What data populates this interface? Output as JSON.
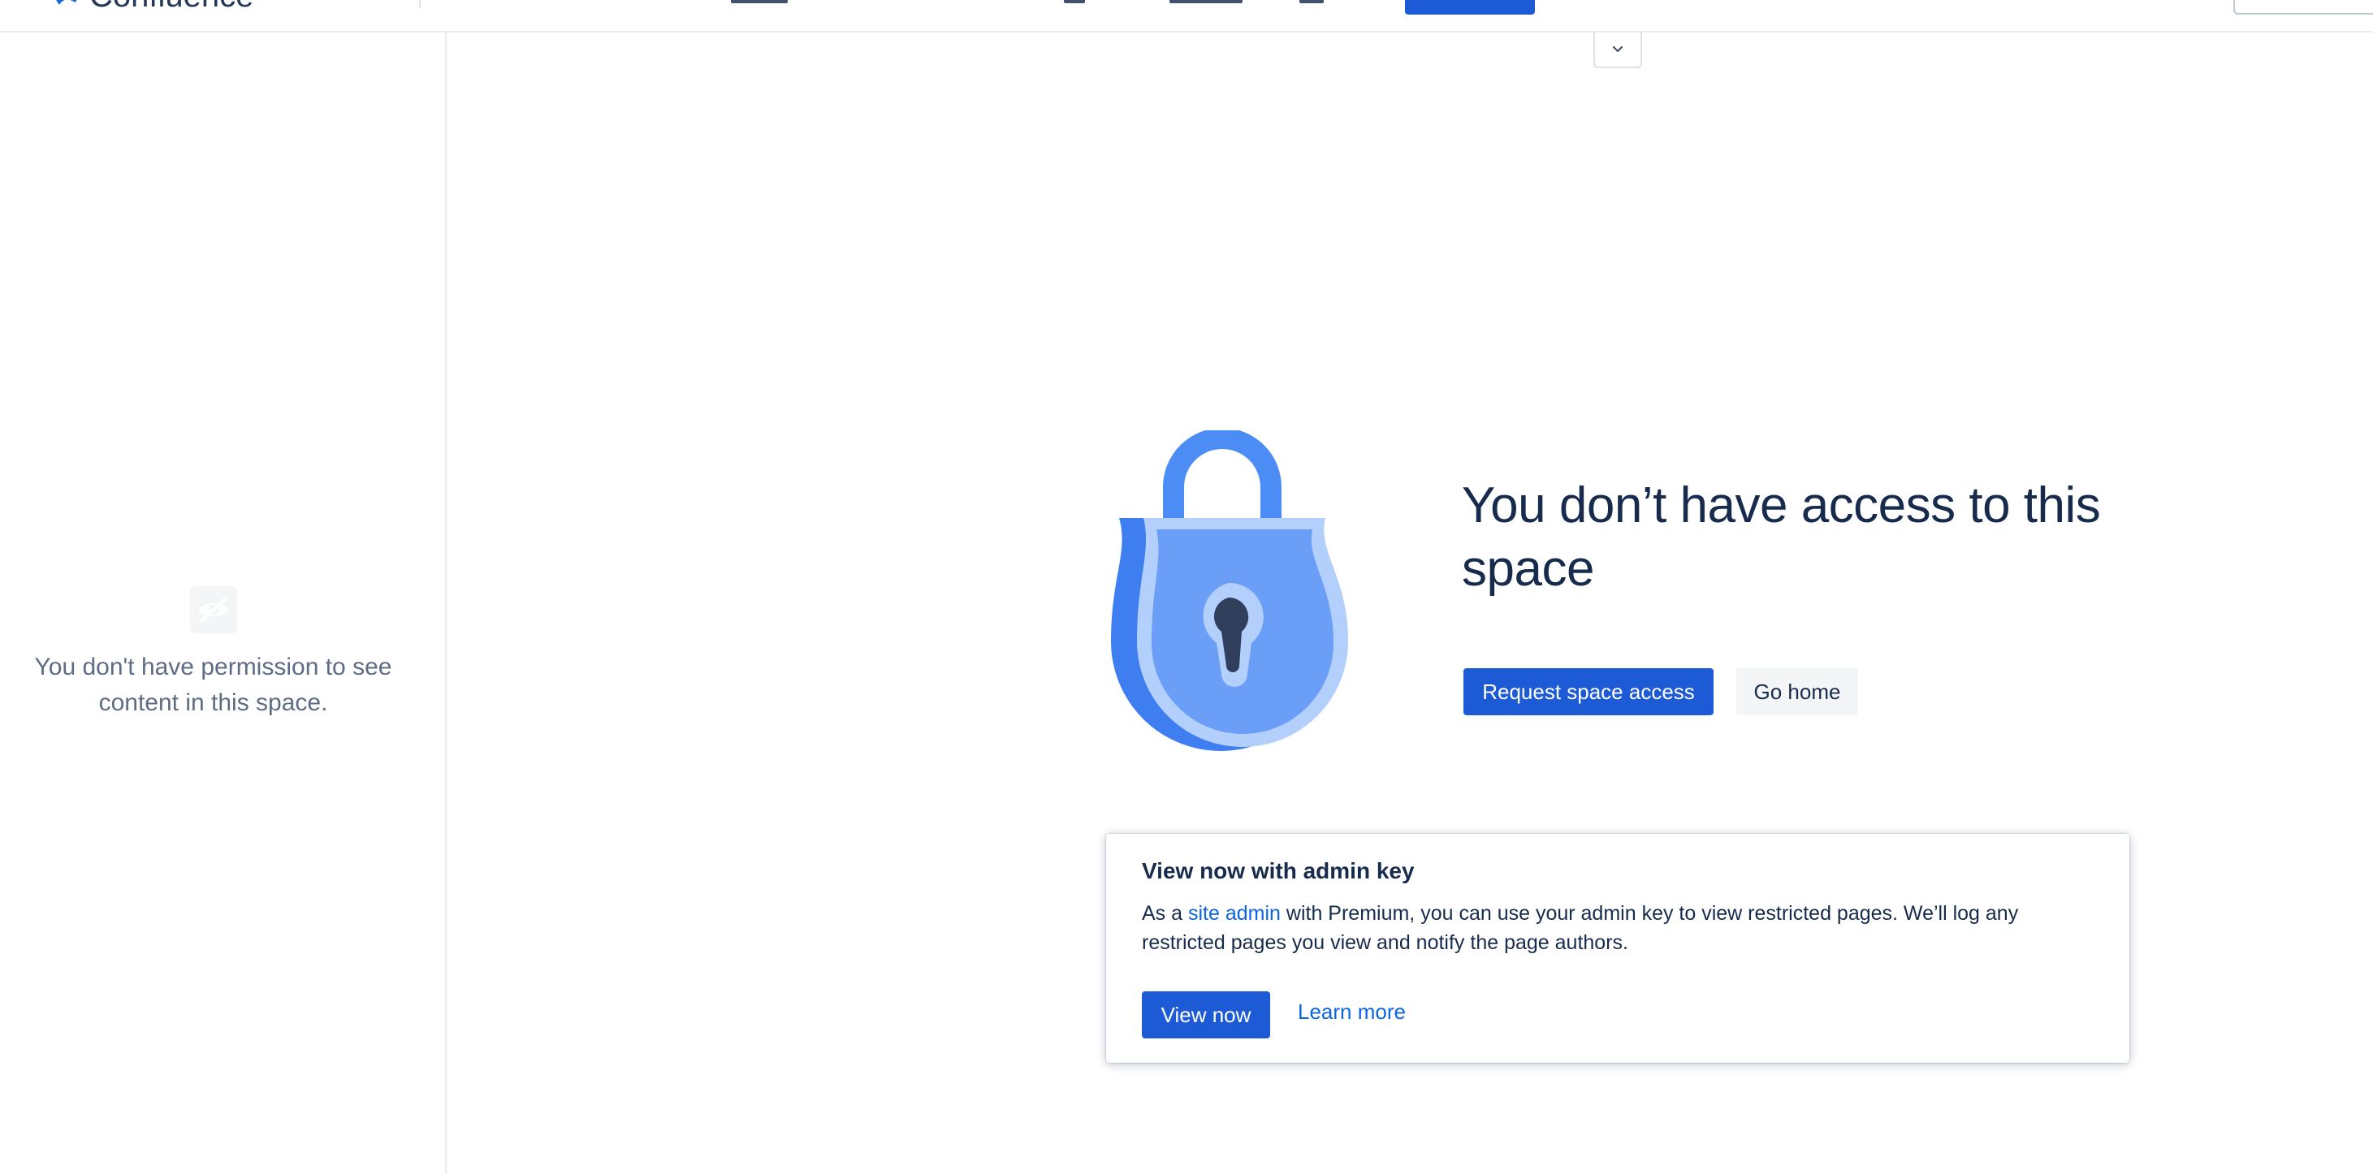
{
  "app": {
    "brand_name": "Confluence",
    "accent_color": "#1d5bd6",
    "link_color": "#0c66e4"
  },
  "header": {
    "collapse_icon": "chevron-down-icon",
    "app_switcher_icon": "grid-icon"
  },
  "sidebar": {
    "icon": "eye-off-icon",
    "message": "You don't have permission to see content in this space."
  },
  "main": {
    "illustration": "lock-icon",
    "headline": "You don’t have access to this space",
    "request_access_label": "Request space access",
    "go_home_label": "Go home"
  },
  "admin_card": {
    "title": "View now with admin key",
    "body_prefix": "As a ",
    "body_link": "site admin",
    "body_suffix": " with Premium, you can use your admin key to view restricted pages. We’ll log any restricted pages you view and notify the page authors.",
    "view_now_label": "View now",
    "learn_more_label": "Learn more"
  }
}
